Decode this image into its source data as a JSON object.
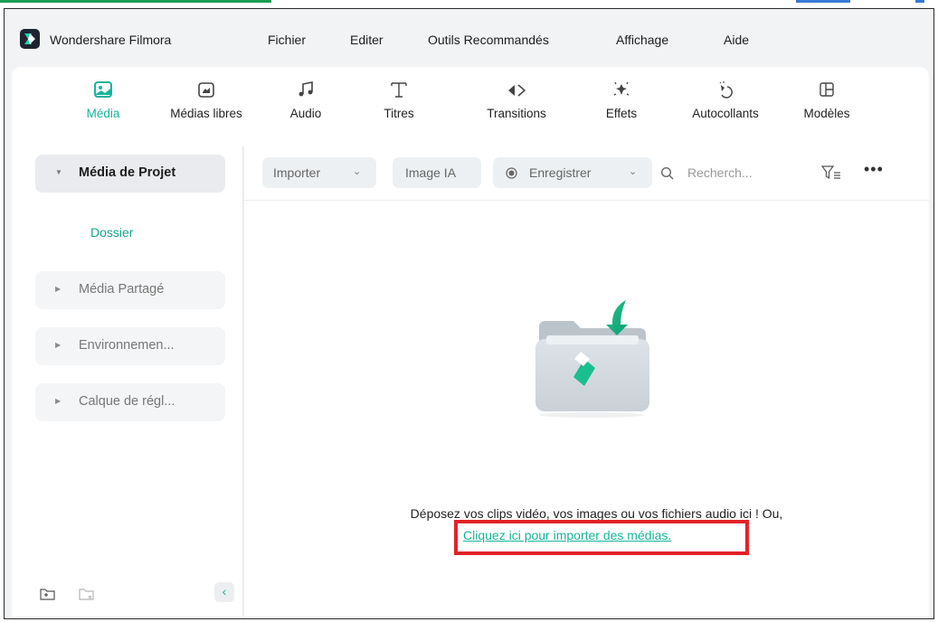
{
  "app": {
    "name": "Wondershare Filmora"
  },
  "menu": [
    "Fichier",
    "Editer",
    "Outils Recommandés",
    "Affichage",
    "Aide"
  ],
  "tools": [
    {
      "label": "Média",
      "icon": "media-icon",
      "active": true
    },
    {
      "label": "Médias libres",
      "icon": "stock-media-icon",
      "active": false
    },
    {
      "label": "Audio",
      "icon": "music-note-icon",
      "active": false
    },
    {
      "label": "Titres",
      "icon": "text-title-icon",
      "active": false
    },
    {
      "label": "Transitions",
      "icon": "transition-icon",
      "active": false
    },
    {
      "label": "Effets",
      "icon": "effects-icon",
      "active": false
    },
    {
      "label": "Autocollants",
      "icon": "sticker-icon",
      "active": false
    },
    {
      "label": "Modèles",
      "icon": "template-icon",
      "active": false
    }
  ],
  "sidebar": {
    "project_media": "Média de Projet",
    "folder": "Dossier",
    "shared_media": "Média Partagé",
    "environment": "Environnemen...",
    "adjustment_layer": "Calque de régl..."
  },
  "toolbar": {
    "import": "Importer",
    "ai_image": "Image IA",
    "record": "Enregistrer",
    "search_placeholder": "Recherch..."
  },
  "empty_state": {
    "drop_text": "Déposez vos clips vidéo, vos images ou vos fichiers audio ici ! Ou,",
    "import_link": "Cliquez ici pour importer des médias."
  },
  "colors": {
    "accent": "#16b59a",
    "highlight": "#e32227",
    "panel": "#ffffff",
    "chrome": "#f1f3f5"
  }
}
